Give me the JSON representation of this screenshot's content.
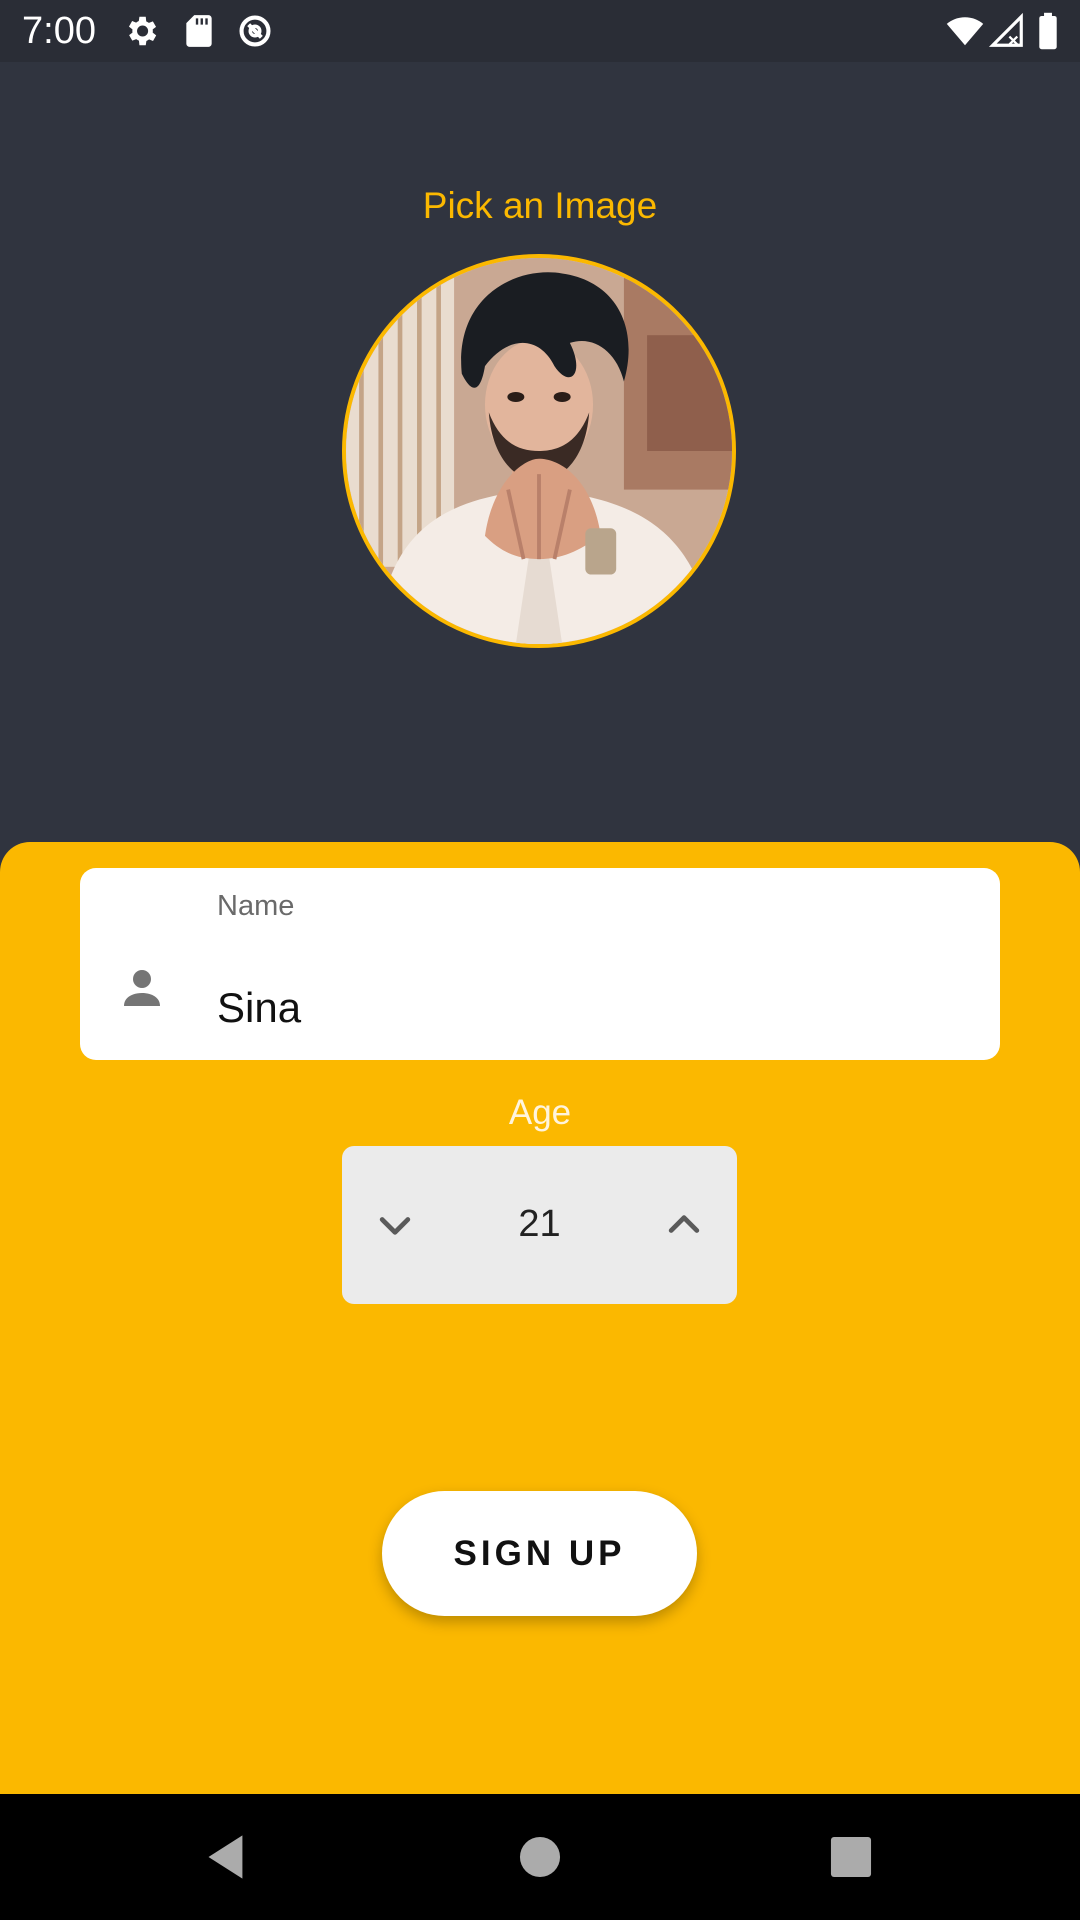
{
  "status_bar": {
    "time": "7:00",
    "left_icons": [
      "gear-icon",
      "sd-card-icon",
      "sync-icon"
    ],
    "right_icons": [
      "wifi-icon",
      "cell-signal-icon",
      "battery-icon"
    ]
  },
  "header": {
    "pick_image_label": "Pick an Image",
    "avatar": "profile-photo"
  },
  "form": {
    "name": {
      "label": "Name",
      "value": "Sina",
      "icon": "person-icon"
    },
    "age": {
      "label": "Age",
      "value": "21",
      "decrement_icon": "chevron-down-icon",
      "increment_icon": "chevron-up-icon"
    },
    "submit_label": "SIGN UP"
  },
  "nav_bar": {
    "buttons": [
      "back-icon",
      "home-icon",
      "recents-icon"
    ]
  },
  "colors": {
    "background": "#30343f",
    "accent": "#fbb800",
    "field": "#ffffff",
    "stepper": "#ebebeb"
  }
}
